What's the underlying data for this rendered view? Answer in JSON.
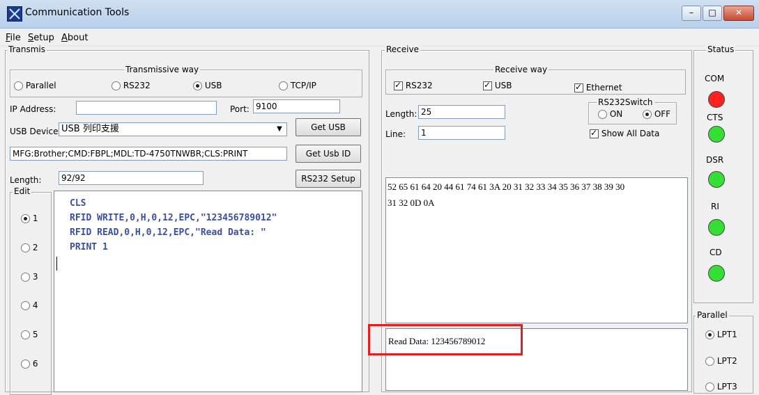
{
  "window": {
    "title": "Communication Tools",
    "minimize": "–",
    "maximize": "□",
    "close": "✕"
  },
  "menu": [
    {
      "accel": "F",
      "rest": "ile"
    },
    {
      "accel": "S",
      "rest": "etup"
    },
    {
      "accel": "A",
      "rest": "bout"
    }
  ],
  "transmit": {
    "label": "Transmis",
    "way_label": "Transmissive way",
    "ways": [
      "Parallel",
      "RS232",
      "USB",
      "TCP/IP"
    ],
    "selected_way": "USB",
    "ip_label": "IP Address:",
    "ip_value": "",
    "port_label": "Port:",
    "port_value": "9100",
    "usb_device_label": "USB Device:",
    "usb_device_value": "USB 列印支援",
    "get_usb": "Get USB",
    "device_id": "MFG:Brother;CMD:FBPL;MDL:TD-4750TNWBR;CLS:PRINT",
    "get_usb_id": "Get Usb ID",
    "length_label": "Length:",
    "length_value": "92/92",
    "rs232_setup": "RS232 Setup"
  },
  "edit": {
    "label": "Edit",
    "slots": [
      "1",
      "2",
      "3",
      "4",
      "5",
      "6"
    ],
    "selected_slot": "1",
    "code_lines": [
      "CLS",
      "RFID WRITE,0,H,0,12,EPC,\"123456789012\"",
      "RFID READ,0,H,0,12,EPC,\"Read Data: \"",
      "PRINT 1"
    ]
  },
  "receive": {
    "label": "Receive",
    "way_label": "Receive way",
    "rs232": "RS232",
    "usb": "USB",
    "ethernet": "Ethernet",
    "length_label": "Length:",
    "length_value": "25",
    "line_label": "Line:",
    "line_value": "1",
    "switch_label": "RS232Switch",
    "switch_on": "ON",
    "switch_off": "OFF",
    "show_all": "Show All Data",
    "hex_line1": "52 65 61 64 20 44 61 74 61 3A 20 31 32 33 34 35 36 37 38 39 30",
    "hex_line2": "31 32 0D 0A",
    "ascii": "Read Data: 123456789012",
    "highlight_color": "#e02020"
  },
  "status": {
    "label": "Status",
    "items": [
      {
        "name": "COM",
        "color": "#ff2020"
      },
      {
        "name": "CTS",
        "color": "#33e033"
      },
      {
        "name": "DSR",
        "color": "#33e033"
      },
      {
        "name": "RI",
        "color": "#33e033"
      },
      {
        "name": "CD",
        "color": "#33e033"
      }
    ]
  },
  "parallel": {
    "label": "Parallel",
    "ports": [
      "LPT1",
      "LPT2",
      "LPT3"
    ],
    "selected": "LPT1"
  }
}
